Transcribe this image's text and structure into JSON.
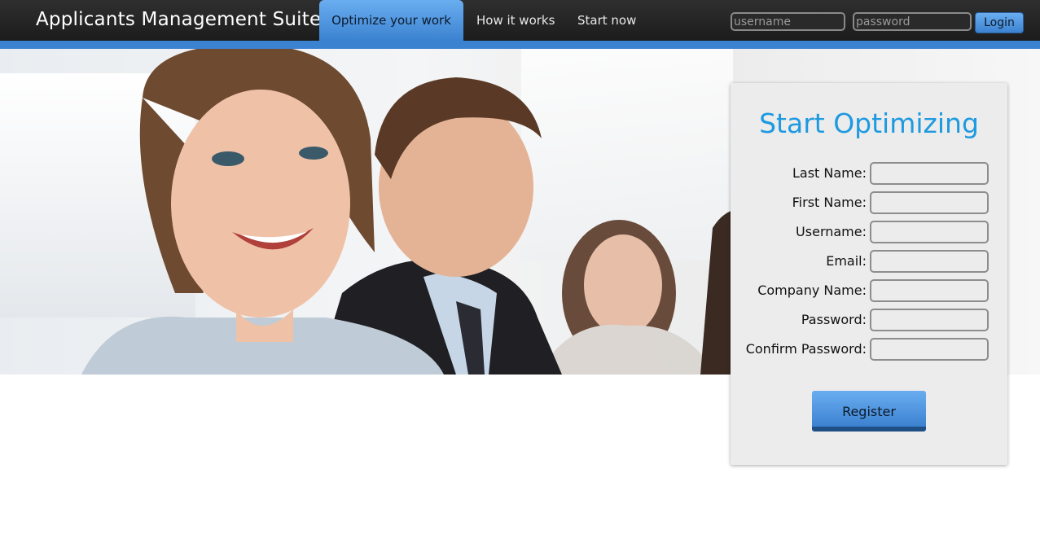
{
  "header": {
    "brand": "Applicants Management Suite",
    "nav": [
      {
        "label": "Optimize your work",
        "active": true
      },
      {
        "label": "How it works",
        "active": false
      },
      {
        "label": "Start now",
        "active": false
      }
    ],
    "login": {
      "username_placeholder": "username",
      "password_placeholder": "password",
      "button_label": "Login"
    }
  },
  "hero": {
    "image": "smiling-business-team-photo"
  },
  "registration": {
    "title": "Start Optimizing",
    "fields": [
      {
        "label": "Last Name:",
        "value": ""
      },
      {
        "label": "First Name:",
        "value": ""
      },
      {
        "label": "Username:",
        "value": ""
      },
      {
        "label": "Email:",
        "value": ""
      },
      {
        "label": "Company Name:",
        "value": ""
      },
      {
        "label": "Password:",
        "value": ""
      },
      {
        "label": "Confirm Password:",
        "value": ""
      }
    ],
    "submit_label": "Register"
  },
  "colors": {
    "accent": "#3b82d0",
    "title_blue": "#1e9ae0",
    "topbar": "#242424"
  }
}
